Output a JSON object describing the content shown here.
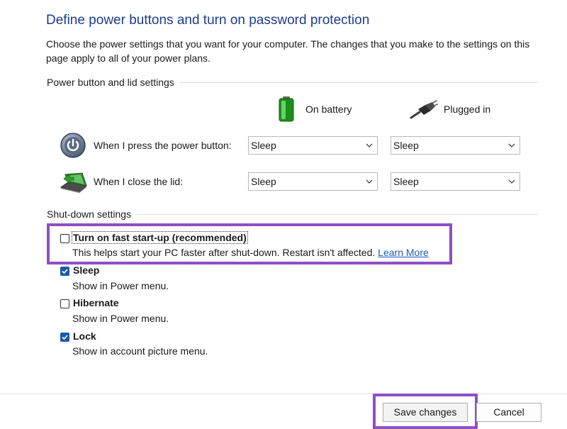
{
  "header": {
    "title": "Define power buttons and turn on password protection",
    "description": "Choose the power settings that you want for your computer. The changes that you make to the settings on this page apply to all of your power plans."
  },
  "power_section": {
    "label": "Power button and lid settings",
    "columns": {
      "battery": {
        "label": "On battery",
        "icon": "battery-icon"
      },
      "plugged": {
        "label": "Plugged in",
        "icon": "power-plug-icon"
      }
    },
    "rows": [
      {
        "label": "When I press the power button:",
        "icon": "power-button-icon",
        "battery": "Sleep",
        "plugged": "Sleep"
      },
      {
        "label": "When I close the lid:",
        "icon": "laptop-lid-icon",
        "battery": "Sleep",
        "plugged": "Sleep"
      }
    ]
  },
  "shutdown_section": {
    "label": "Shut-down settings",
    "options": [
      {
        "label": "Turn on fast start-up (recommended)",
        "checked": false,
        "description": "This helps start your PC faster after shut-down. Restart isn't affected.",
        "link": "Learn More"
      },
      {
        "label": "Sleep",
        "checked": true,
        "description": "Show in Power menu."
      },
      {
        "label": "Hibernate",
        "checked": false,
        "description": "Show in Power menu."
      },
      {
        "label": "Lock",
        "checked": true,
        "description": "Show in account picture menu."
      }
    ]
  },
  "footer": {
    "save_label": "Save changes",
    "cancel_label": "Cancel"
  },
  "colors": {
    "title": "#1e3c8c",
    "highlight": "#8e4fc4",
    "checkbox_checked": "#1c5ba8",
    "link": "#1d5bb8"
  }
}
